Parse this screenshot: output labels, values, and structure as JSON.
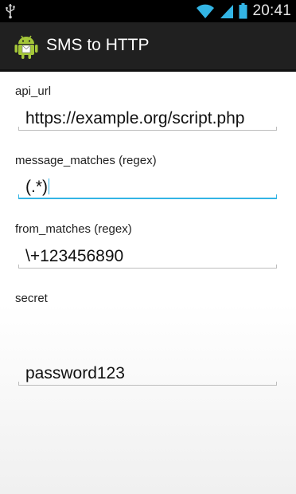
{
  "status_bar": {
    "time": "20:41",
    "icons": [
      "usb-icon",
      "wifi-icon",
      "signal-icon",
      "battery-icon"
    ]
  },
  "action_bar": {
    "title": "SMS to HTTP",
    "icon": "android-icon"
  },
  "form": {
    "api_url": {
      "label": "api_url",
      "value": "https://example.org/script.php"
    },
    "message_matches": {
      "label": "message_matches (regex)",
      "value": "(.*)"
    },
    "from_matches": {
      "label": "from_matches (regex)",
      "value": "\\+123456890"
    },
    "secret": {
      "label": "secret",
      "value": "password123"
    }
  },
  "colors": {
    "focus_accent": "#33b5e5",
    "action_bar_bg": "#202020",
    "status_bar_bg": "#000000"
  }
}
